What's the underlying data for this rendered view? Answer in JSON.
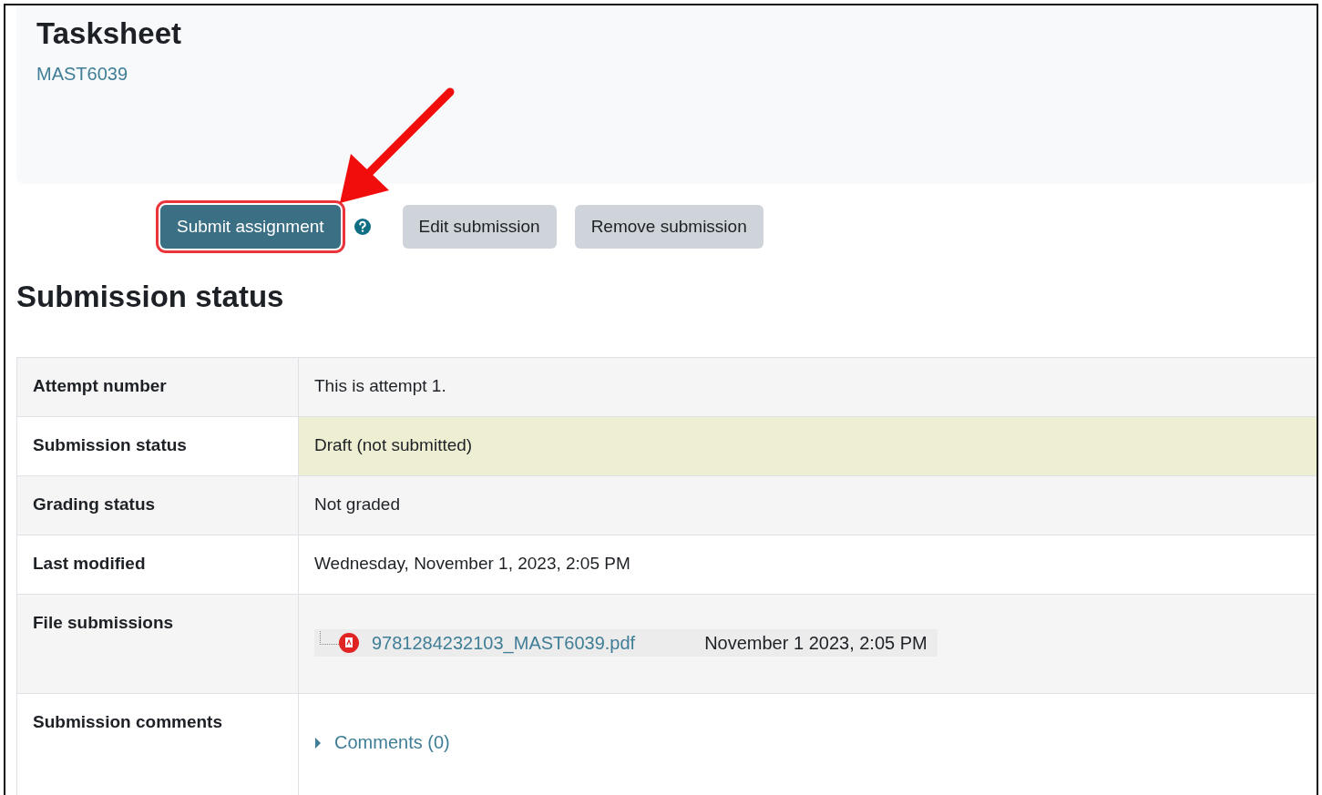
{
  "header": {
    "title": "Tasksheet",
    "course": "MAST6039"
  },
  "actions": [
    {
      "label": "Submit assignment",
      "kind": "primary",
      "highlighted": true
    },
    {
      "kind": "help"
    },
    {
      "label": "Edit submission",
      "kind": "secondary",
      "highlighted": false
    },
    {
      "label": "Remove submission",
      "kind": "secondary",
      "highlighted": false
    }
  ],
  "section_title": "Submission status",
  "rows": [
    {
      "label": "Attempt number",
      "kind": "text",
      "value": "This is attempt 1.",
      "highlighted": false
    },
    {
      "label": "Submission status",
      "kind": "text",
      "value": "Draft (not submitted)",
      "highlighted": true
    },
    {
      "label": "Grading status",
      "kind": "text",
      "value": "Not graded",
      "highlighted": false
    },
    {
      "label": "Last modified",
      "kind": "text",
      "value": "Wednesday, November 1, 2023, 2:05 PM",
      "highlighted": false
    },
    {
      "label": "File submissions",
      "kind": "file",
      "file": "9781284232103_MAST6039.pdf",
      "date": "November 1 2023, 2:05 PM",
      "highlighted": false
    },
    {
      "label": "Submission comments",
      "kind": "comments",
      "link": "Comments (0)",
      "expanded": false,
      "highlighted": false
    }
  ]
}
